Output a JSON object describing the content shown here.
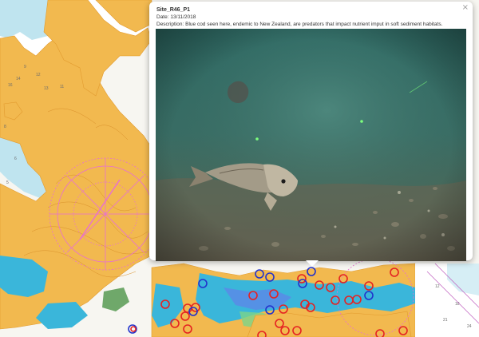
{
  "popup": {
    "title": "Site_R46_P1",
    "date": "Date: 13/11/2018",
    "description": "Description: Blue cod seen here, endemic to New Zealand, are predators that impact nutrient imput in soft sediment habitats.",
    "close_icon": "close-icon",
    "photo_subject": "blue cod on seafloor"
  },
  "map": {
    "colors": {
      "land": "#f2b94f",
      "sea": "#ffffff",
      "shallow": "#bde6f1",
      "habitat": "#36b4d8",
      "compass": "#e86fd2",
      "marker_red": "#e52222",
      "marker_blue": "#2233cc"
    },
    "markers": [
      {
        "color": "red"
      },
      {
        "color": "red"
      },
      {
        "color": "red"
      },
      {
        "color": "red"
      },
      {
        "color": "red"
      },
      {
        "color": "red"
      },
      {
        "color": "red"
      },
      {
        "color": "red"
      },
      {
        "color": "red"
      },
      {
        "color": "red"
      },
      {
        "color": "blue"
      },
      {
        "color": "blue"
      },
      {
        "color": "blue"
      },
      {
        "color": "blue"
      },
      {
        "color": "blue"
      }
    ]
  }
}
